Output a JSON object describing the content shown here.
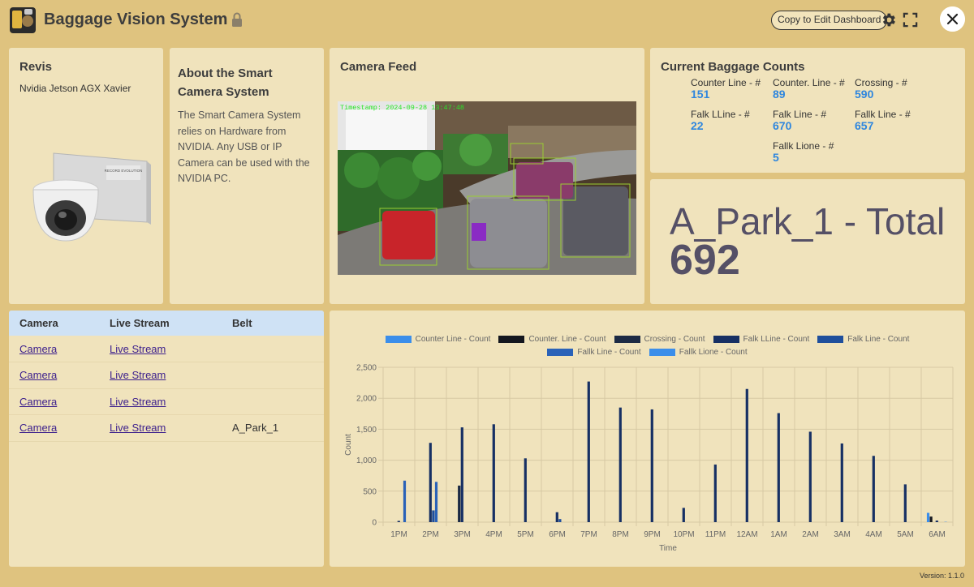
{
  "header": {
    "title": "Baggage Vision System",
    "copy_button": "Copy to Edit Dashboard"
  },
  "revis": {
    "title": "Revis",
    "subtitle": "Nvidia Jetson AGX Xavier",
    "device_label": "RECORD EVOLUTION"
  },
  "about": {
    "title": "About the Smart Camera System",
    "text": "The Smart Camera System relies on Hardware from NVIDIA. Any USB or IP Camera can be used with the NVIDIA PC."
  },
  "feed": {
    "title": "Camera Feed",
    "timestamp": "Timestamp: 2024-09-28 13:47:48"
  },
  "counts": {
    "title": "Current Baggage Counts",
    "items": [
      {
        "label": "Counter Line - #",
        "value": "151"
      },
      {
        "label": "Counter. Line - #",
        "value": "89"
      },
      {
        "label": "Crossing - #",
        "value": "590"
      },
      {
        "label": "Falk LLine - #",
        "value": "22"
      },
      {
        "label": "Falk Line - #",
        "value": "670"
      },
      {
        "label": "Fallk Line - #",
        "value": "657"
      },
      {
        "label": "Fallk Lione - #",
        "value": "5"
      }
    ]
  },
  "total": {
    "label": "A_Park_1 - Total",
    "value": "692"
  },
  "table": {
    "headers": [
      "Camera",
      "Live Stream",
      "Belt"
    ],
    "rows": [
      {
        "camera": "Camera",
        "stream": "Live Stream",
        "belt": ""
      },
      {
        "camera": "Camera",
        "stream": "Live Stream",
        "belt": ""
      },
      {
        "camera": "Camera",
        "stream": "Live Stream",
        "belt": ""
      },
      {
        "camera": "Camera",
        "stream": "Live Stream",
        "belt": "A_Park_1"
      }
    ]
  },
  "chart_data": {
    "type": "bar",
    "title": "",
    "xlabel": "Time",
    "ylabel": "Count",
    "ylim": [
      0,
      2500
    ],
    "yticks": [
      0,
      500,
      1000,
      1500,
      2000,
      2500
    ],
    "ytick_labels": [
      "0",
      "500",
      "1,000",
      "1,500",
      "2,000",
      "2,500"
    ],
    "grid": true,
    "legend_position": "top-center",
    "categories": [
      "1PM",
      "2PM",
      "3PM",
      "4PM",
      "5PM",
      "6PM",
      "7PM",
      "8PM",
      "9PM",
      "10PM",
      "11PM",
      "12AM",
      "1AM",
      "2AM",
      "3AM",
      "4AM",
      "5AM",
      "6AM"
    ],
    "series": [
      {
        "name": "Counter Line - Count",
        "color": "#3b8eea",
        "values": [
          0,
          0,
          0,
          0,
          0,
          0,
          0,
          0,
          0,
          0,
          0,
          0,
          0,
          0,
          0,
          0,
          0,
          150
        ]
      },
      {
        "name": "Counter. Line - Count",
        "color": "#14171f",
        "values": [
          0,
          0,
          0,
          0,
          0,
          0,
          0,
          0,
          0,
          0,
          0,
          0,
          0,
          0,
          0,
          0,
          0,
          90
        ]
      },
      {
        "name": "Crossing - Count",
        "color": "#1c2a44",
        "values": [
          0,
          0,
          590,
          0,
          0,
          0,
          0,
          0,
          0,
          0,
          0,
          0,
          0,
          0,
          0,
          0,
          0,
          0
        ]
      },
      {
        "name": "Falk LLine - Count",
        "color": "#173064",
        "values": [
          20,
          1280,
          1530,
          1580,
          1030,
          160,
          2270,
          1850,
          1820,
          230,
          930,
          2150,
          1760,
          1460,
          1270,
          1070,
          610,
          25
        ]
      },
      {
        "name": "Falk Line - Count",
        "color": "#1f4f9c",
        "values": [
          0,
          190,
          0,
          0,
          0,
          50,
          0,
          0,
          0,
          0,
          0,
          0,
          0,
          0,
          0,
          0,
          0,
          0
        ]
      },
      {
        "name": "Fallk Line - Count",
        "color": "#2a62b8",
        "values": [
          670,
          650,
          0,
          0,
          0,
          0,
          0,
          0,
          0,
          0,
          0,
          0,
          0,
          0,
          0,
          0,
          0,
          0
        ]
      },
      {
        "name": "Fallk Lione - Count",
        "color": "#3b8eea",
        "values": [
          0,
          0,
          0,
          0,
          0,
          0,
          0,
          0,
          0,
          0,
          0,
          0,
          0,
          0,
          0,
          0,
          0,
          5
        ]
      }
    ]
  },
  "version": "Version: 1.1.0"
}
